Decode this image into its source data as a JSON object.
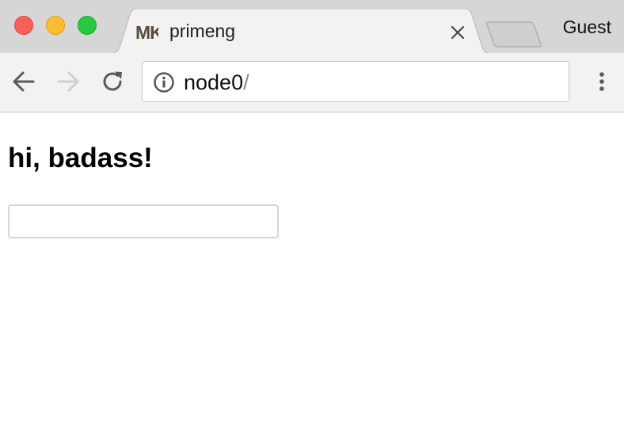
{
  "window": {
    "traffic_lights": {
      "close_color": "#fe5f57",
      "minimize_color": "#febc2e",
      "maximize_color": "#28c840"
    },
    "profile_label": "Guest"
  },
  "tab": {
    "favicon_text": "MK",
    "title": "primeng",
    "close_icon": "close-x-icon",
    "active_background": "#f2f2f2"
  },
  "new_tab": {
    "icon": "new-tab-icon"
  },
  "toolbar": {
    "back_icon": "arrow-left-icon",
    "forward_icon": "arrow-right-icon",
    "forward_enabled": false,
    "reload_icon": "reload-icon",
    "menu_icon": "vertical-dots-icon"
  },
  "omnibox": {
    "security_icon": "info-circle-icon",
    "host": "node0",
    "path": "/"
  },
  "page": {
    "heading": "hi, badass!",
    "input": {
      "value": "",
      "placeholder": ""
    }
  }
}
